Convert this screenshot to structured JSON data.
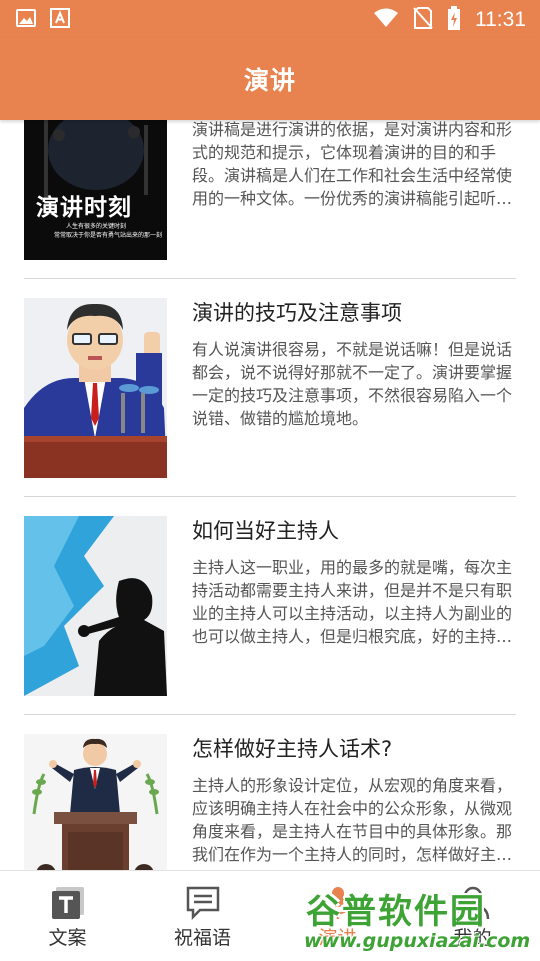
{
  "status_bar": {
    "time": "11:31",
    "left_icons": [
      "image-icon",
      "text-a-icon"
    ],
    "right_icons": [
      "wifi-icon",
      "no-sim-icon",
      "battery-charging-icon"
    ]
  },
  "app_bar": {
    "title": "演讲"
  },
  "articles": [
    {
      "title": "",
      "desc": "演讲稿是进行演讲的依据，是对演讲内容和形式的规范和提示，它体现着演讲的目的和手段。演讲稿是人们在工作和社会生活中经常使用的一种文体。一份优秀的演讲稿能引起听众的共鸣，小编收集了优...",
      "thumb": {
        "headline": "演讲时刻",
        "line1": "人生有很多的关键时刻",
        "line2": "常常取决于你是否有勇气站出来的那一刻"
      }
    },
    {
      "title": "演讲的技巧及注意事项",
      "desc": "有人说演讲很容易，不就是说话嘛！但是说话都会，说不说得好那就不一定了。演讲要掌握一定的技巧及注意事项，不然很容易陷入一个说错、做错的尴尬境地。"
    },
    {
      "title": "如何当好主持人",
      "desc": "主持人这一职业，用的最多的就是嘴，每次主持活动都需要主持人来讲，但是并不是只有职业的主持人可以主持活动，以主持人为副业的也可以做主持人，但是归根究底，好的主持人带来的是欢乐，那么..."
    },
    {
      "title": "怎样做好主持人话术?",
      "desc": "主持人的形象设计定位，从宏观的角度来看，应该明确主持人在社会中的公众形象，从微观角度来看，是主持人在节目中的具体形象。那我们在作为一个主持人的同时，怎样做好主持人话术呢?"
    }
  ],
  "tabs": [
    {
      "label": "文案",
      "icon": "text-t-icon",
      "active": false
    },
    {
      "label": "祝福语",
      "icon": "message-icon",
      "active": false
    },
    {
      "label": "演讲",
      "icon": "microphone-icon",
      "active": true
    },
    {
      "label": "我的",
      "icon": "person-icon",
      "active": false
    }
  ],
  "watermark": {
    "title": "谷普软件园",
    "url": "www.gupuxiazai.com"
  },
  "colors": {
    "accent": "#e8824f",
    "watermark_green": "#3ea335"
  }
}
